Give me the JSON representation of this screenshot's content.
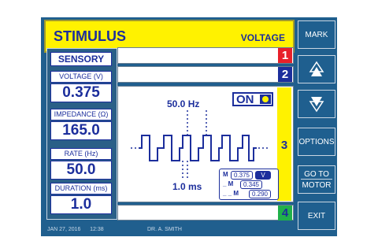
{
  "header": {
    "title": "STIMULUS",
    "mode": "VOLTAGE"
  },
  "sensory_label": "SENSORY",
  "params": [
    {
      "label": "VOLTAGE (V)",
      "value": "0.375"
    },
    {
      "label": "IMPEDANCE (Ω)",
      "value": "165.0"
    },
    {
      "label": "RATE (Hz)",
      "value": "50.0"
    },
    {
      "label": "DURATION (ms)",
      "value": "1.0"
    }
  ],
  "channels": [
    {
      "number": "1",
      "color": "#e8202a"
    },
    {
      "number": "2",
      "color": "#1c2e9c"
    },
    {
      "number": "3",
      "color": "#fff200"
    },
    {
      "number": "4",
      "color": "#20b04a"
    }
  ],
  "waveform": {
    "frequency": "50.0 Hz",
    "pulse_width": "1.0 ms",
    "state": "ON",
    "measurements": [
      {
        "label": "M",
        "value": "0.375",
        "unit": "V"
      },
      {
        "label": "_ M",
        "value": "0.345"
      },
      {
        "label": "_ _ M",
        "value": "0.290"
      }
    ]
  },
  "softkeys": {
    "mark": "MARK",
    "options": "OPTIONS",
    "goto_line1": "GO TO",
    "goto_line2": "MOTOR",
    "exit": "EXIT"
  },
  "footer": {
    "date": "JAN 27, 2016",
    "time": "12:38",
    "doctor": "DR. A. SMITH"
  },
  "colors": {
    "panel": "#205f8e",
    "header": "#fff200",
    "text": "#1c2e9c"
  }
}
